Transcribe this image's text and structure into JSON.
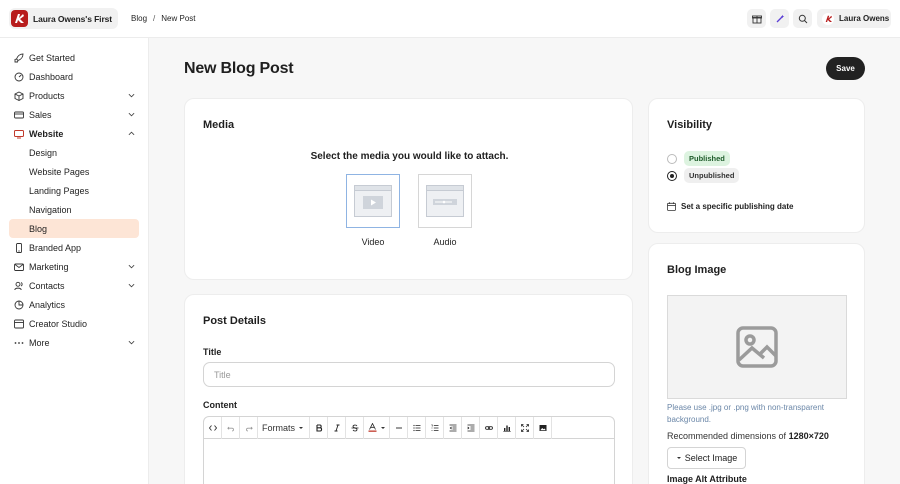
{
  "header": {
    "brand_name": "Laura Owens's First",
    "breadcrumb": [
      "Blog",
      "New Post"
    ],
    "breadcrumb_sep": "/",
    "user_name": "Laura Owens",
    "brand_color": "#b81d1d"
  },
  "sidebar": {
    "items": [
      {
        "label": "Get Started",
        "icon": "rocket-icon"
      },
      {
        "label": "Dashboard",
        "icon": "dashboard-icon"
      },
      {
        "label": "Products",
        "icon": "box-icon"
      },
      {
        "label": "Sales",
        "icon": "cash-icon"
      },
      {
        "label": "Website",
        "icon": "monitor-icon"
      },
      {
        "label": "Design"
      },
      {
        "label": "Website Pages"
      },
      {
        "label": "Landing Pages"
      },
      {
        "label": "Navigation"
      },
      {
        "label": "Blog"
      },
      {
        "label": "Branded App",
        "icon": "phone-icon"
      },
      {
        "label": "Marketing",
        "icon": "mail-icon"
      },
      {
        "label": "Contacts",
        "icon": "contacts-icon"
      },
      {
        "label": "Analytics",
        "icon": "analytics-icon"
      },
      {
        "label": "Creator Studio",
        "icon": "studio-icon"
      },
      {
        "label": "More",
        "icon": "more-icon"
      }
    ],
    "active_color": "#fde5d6"
  },
  "main": {
    "page_title": "New Blog Post",
    "save_label": "Save"
  },
  "media": {
    "title": "Media",
    "prompt": "Select the media you would like to attach.",
    "options": [
      "Video",
      "Audio"
    ]
  },
  "post_details": {
    "title": "Post Details",
    "title_label": "Title",
    "title_placeholder": "Title",
    "content_label": "Content",
    "formats_label": "Formats"
  },
  "visibility": {
    "title": "Visibility",
    "published": "Published",
    "unpublished": "Unpublished",
    "schedule": "Set a specific publishing date"
  },
  "blog_image": {
    "title": "Blog Image",
    "hint": "Please use .jpg or .png with non-transparent background.",
    "rec_prefix": "Recommended dimensions of",
    "rec_dims": "1280×720",
    "select_label": "Select Image",
    "alt_label": "Image Alt Attribute"
  }
}
